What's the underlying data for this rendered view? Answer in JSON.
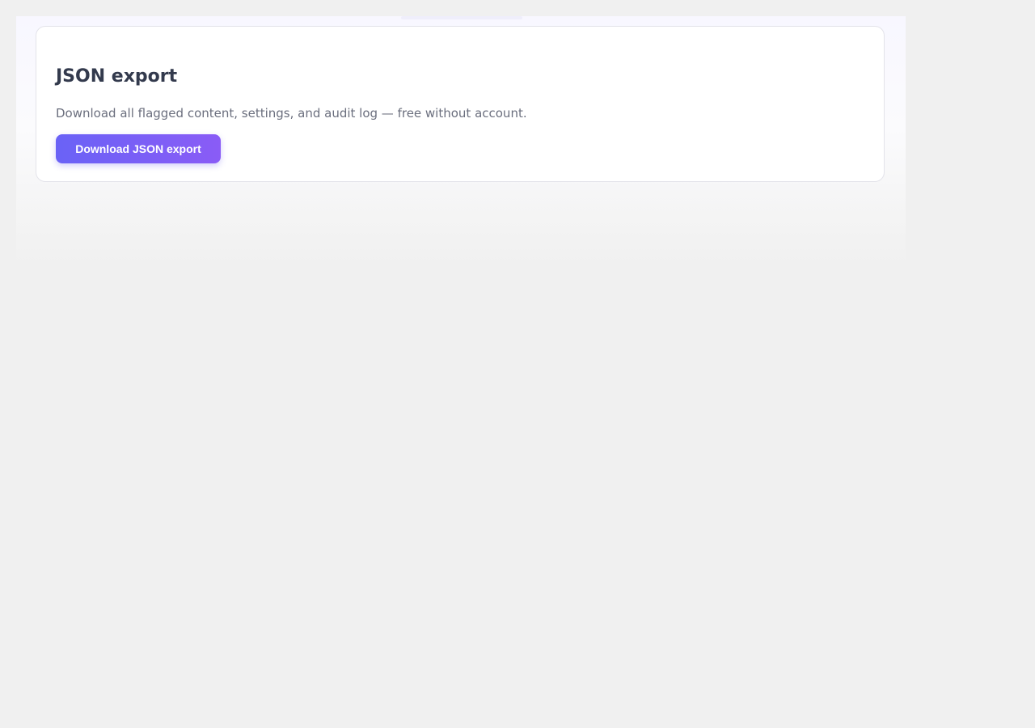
{
  "export_card": {
    "title": "JSON export",
    "description": "Download all flagged content, settings, and audit log — free without account.",
    "button_label": "Download JSON export"
  },
  "colors": {
    "page_background": "#f0f0f0",
    "card_background": "#ffffff",
    "card_border": "#e3e3ea",
    "title_text": "#333a4d",
    "description_text": "#6b6f7e",
    "button_gradient_start": "#6a62f6",
    "button_gradient_end": "#8a5cf6",
    "button_text": "#ffffff"
  }
}
